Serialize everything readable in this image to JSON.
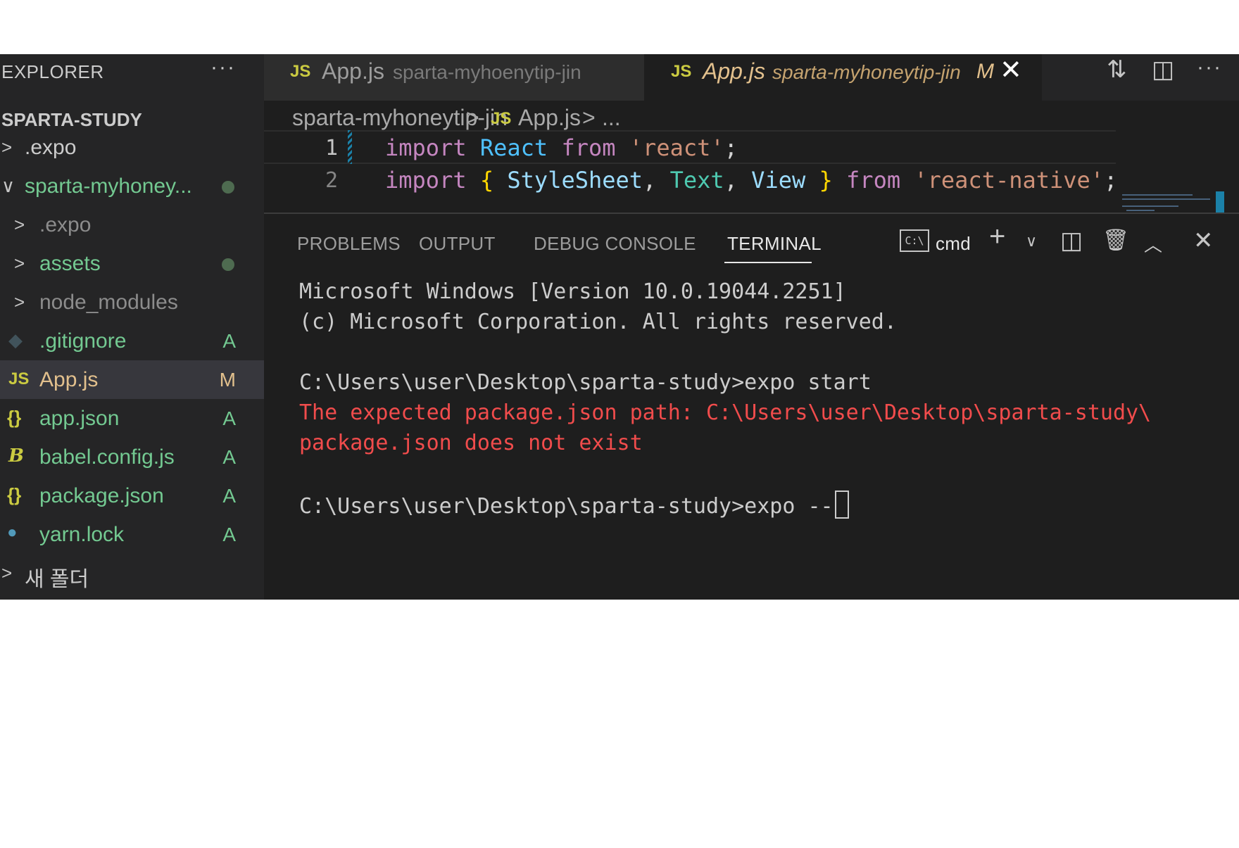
{
  "sidebar": {
    "title": "EXPLORER",
    "more": "···",
    "workspace": "SPARTA-STUDY",
    "items": [
      {
        "chevron": ">",
        "label": ".expo",
        "color": "#cccccc"
      },
      {
        "chevron": "∨",
        "label": "sparta-myhoney...",
        "color": "#73c991",
        "decoration": "dot"
      },
      {
        "chevron": ">",
        "label": ".expo",
        "color": "#8c8c8c"
      },
      {
        "chevron": ">",
        "label": "assets",
        "color": "#73c991",
        "decoration": "dot"
      },
      {
        "chevron": ">",
        "label": "node_modules",
        "color": "#8c8c8c"
      },
      {
        "icon": "git-icon",
        "label": ".gitignore",
        "color": "#73c991",
        "status": "A"
      },
      {
        "icon": "js-icon",
        "icon_text": "JS",
        "label": "App.js",
        "color": "#e2c08d",
        "status": "M",
        "selected": true
      },
      {
        "icon": "json-icon",
        "icon_text": "{}",
        "label": "app.json",
        "color": "#73c991",
        "status": "A"
      },
      {
        "icon": "babel-icon",
        "icon_text": "B",
        "label": "babel.config.js",
        "color": "#73c991",
        "status": "A"
      },
      {
        "icon": "json-icon",
        "icon_text": "{}",
        "label": "package.json",
        "color": "#73c991",
        "status": "A"
      },
      {
        "icon": "yarn-icon",
        "icon_text": "🐈",
        "label": "yarn.lock",
        "color": "#73c991",
        "status": "A"
      },
      {
        "chevron": ">",
        "label": "새 폴더",
        "color": "#cccccc"
      }
    ]
  },
  "tabs": [
    {
      "icon_text": "JS",
      "name": "App.js",
      "desc": "sparta-myhoenytip-jin"
    },
    {
      "icon_text": "JS",
      "name": "App.js",
      "desc": "sparta-myhoneytip-jin",
      "mod": "M",
      "close": "✕"
    }
  ],
  "breadcrumb": {
    "folder": "sparta-myhoneytip-jin",
    "sep": ">",
    "icon_text": "JS",
    "file": "App.js",
    "more": "..."
  },
  "editor": {
    "lines": [
      {
        "number": "1",
        "kw1": "import",
        "a": "React",
        "kw2": "from",
        "str": "'react'",
        "end": ";"
      },
      {
        "number": "2",
        "kw1": "import",
        "ob": "{",
        "a": "StyleSheet",
        "b": "Text",
        "c": "View",
        "cb": "}",
        "kw2": "from",
        "str": "'react-native'",
        "end": ";"
      }
    ]
  },
  "panel": {
    "tabs": [
      "PROBLEMS",
      "OUTPUT",
      "DEBUG CONSOLE",
      "TERMINAL"
    ],
    "active_tab": "TERMINAL",
    "terminal_icon_text": "C:\\",
    "terminal_name": "cmd",
    "terminal": {
      "line1": "Microsoft Windows [Version 10.0.19044.2251]",
      "line2": "(c) Microsoft Corporation. All rights reserved.",
      "line3": "C:\\Users\\user\\Desktop\\sparta-study>expo start",
      "err1": "The expected package.json path: C:\\Users\\user\\Desktop\\sparta-study\\",
      "err2": "package.json does not exist",
      "line4": "C:\\Users\\user\\Desktop\\sparta-study>expo --"
    }
  },
  "colors": {
    "editor_bg": "#1e1e1e",
    "sidebar_bg": "#252526",
    "added": "#73c991",
    "modified": "#e2c08d",
    "error": "#f14c4c",
    "js_yellow": "#cbcb41"
  }
}
